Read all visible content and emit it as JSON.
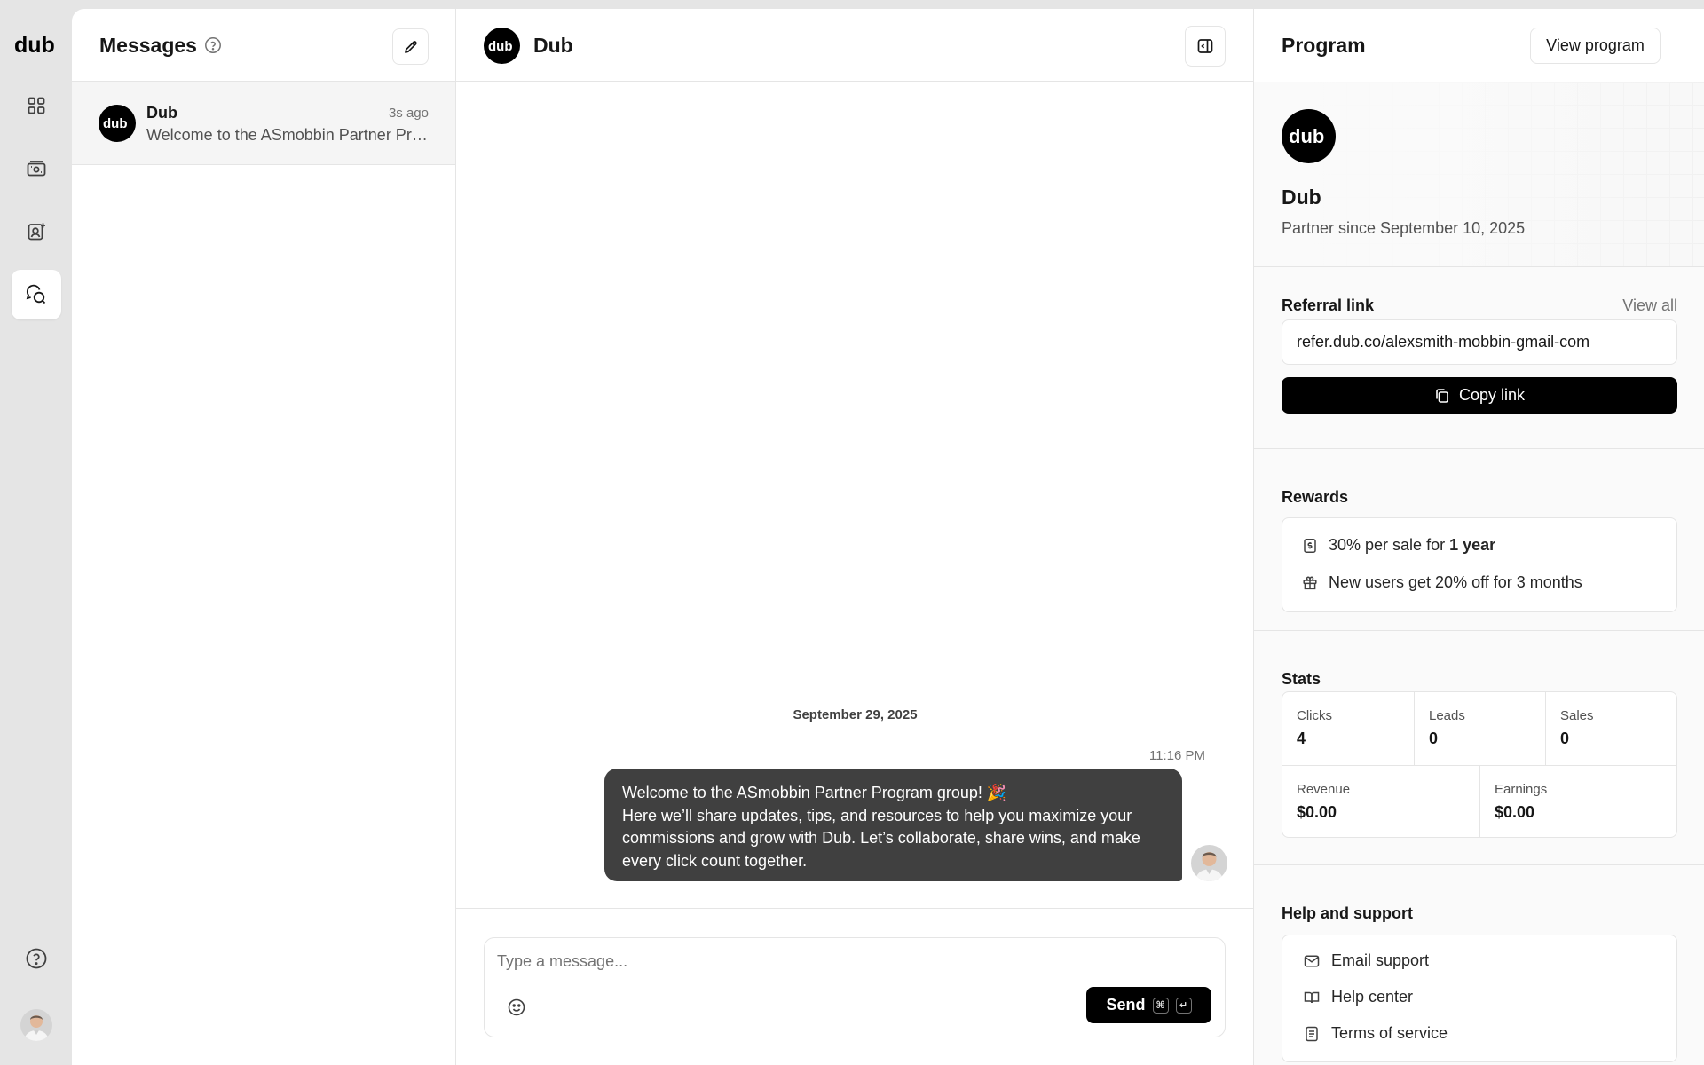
{
  "rail": {
    "logo_text": "dub",
    "items": [
      {
        "icon": "grid-icon"
      },
      {
        "icon": "cash-icon"
      },
      {
        "icon": "user-add-icon"
      },
      {
        "icon": "messages-icon",
        "active": true
      }
    ],
    "help_icon": "help-circle-icon"
  },
  "messages_list": {
    "title": "Messages",
    "conversations": [
      {
        "name": "Dub",
        "time": "3s ago",
        "preview": "Welcome to the ASmobbin Partner Program group! 🎉"
      }
    ]
  },
  "chat": {
    "title": "Dub",
    "date_separator": "September 29, 2025",
    "message": {
      "time": "11:16 PM",
      "line1": "Welcome to the ASmobbin Partner Program group! 🎉",
      "line2": "Here we’ll share updates, tips, and resources to help you maximize your commissions and grow with Dub. Let’s collaborate, share wins, and make every click count together."
    },
    "composer": {
      "placeholder": "Type a message...",
      "send_label": "Send",
      "kbd_cmd": "⌘",
      "kbd_enter": "↵"
    }
  },
  "program": {
    "title": "Program",
    "view_program_label": "View program",
    "name": "Dub",
    "partner_since": "Partner since September 10, 2025",
    "referral": {
      "title": "Referral link",
      "view_all": "View all",
      "link": "refer.dub.co/alexsmith-mobbin-gmail-com",
      "copy_label": "Copy link"
    },
    "rewards": {
      "title": "Rewards",
      "sale_prefix": "30% per sale for ",
      "sale_duration": "1 year",
      "discount": "New users get 20% off for 3 months"
    },
    "stats": {
      "title": "Stats",
      "clicks_label": "Clicks",
      "clicks": "4",
      "leads_label": "Leads",
      "leads": "0",
      "sales_label": "Sales",
      "sales": "0",
      "revenue_label": "Revenue",
      "revenue": "$0.00",
      "earnings_label": "Earnings",
      "earnings": "$0.00"
    },
    "help": {
      "title": "Help and support",
      "email": "Email support",
      "center": "Help center",
      "terms": "Terms of service"
    }
  },
  "colors": {
    "bubble": "#404040",
    "primary_button": "#000000",
    "rail_bg": "#e5e5e5"
  }
}
